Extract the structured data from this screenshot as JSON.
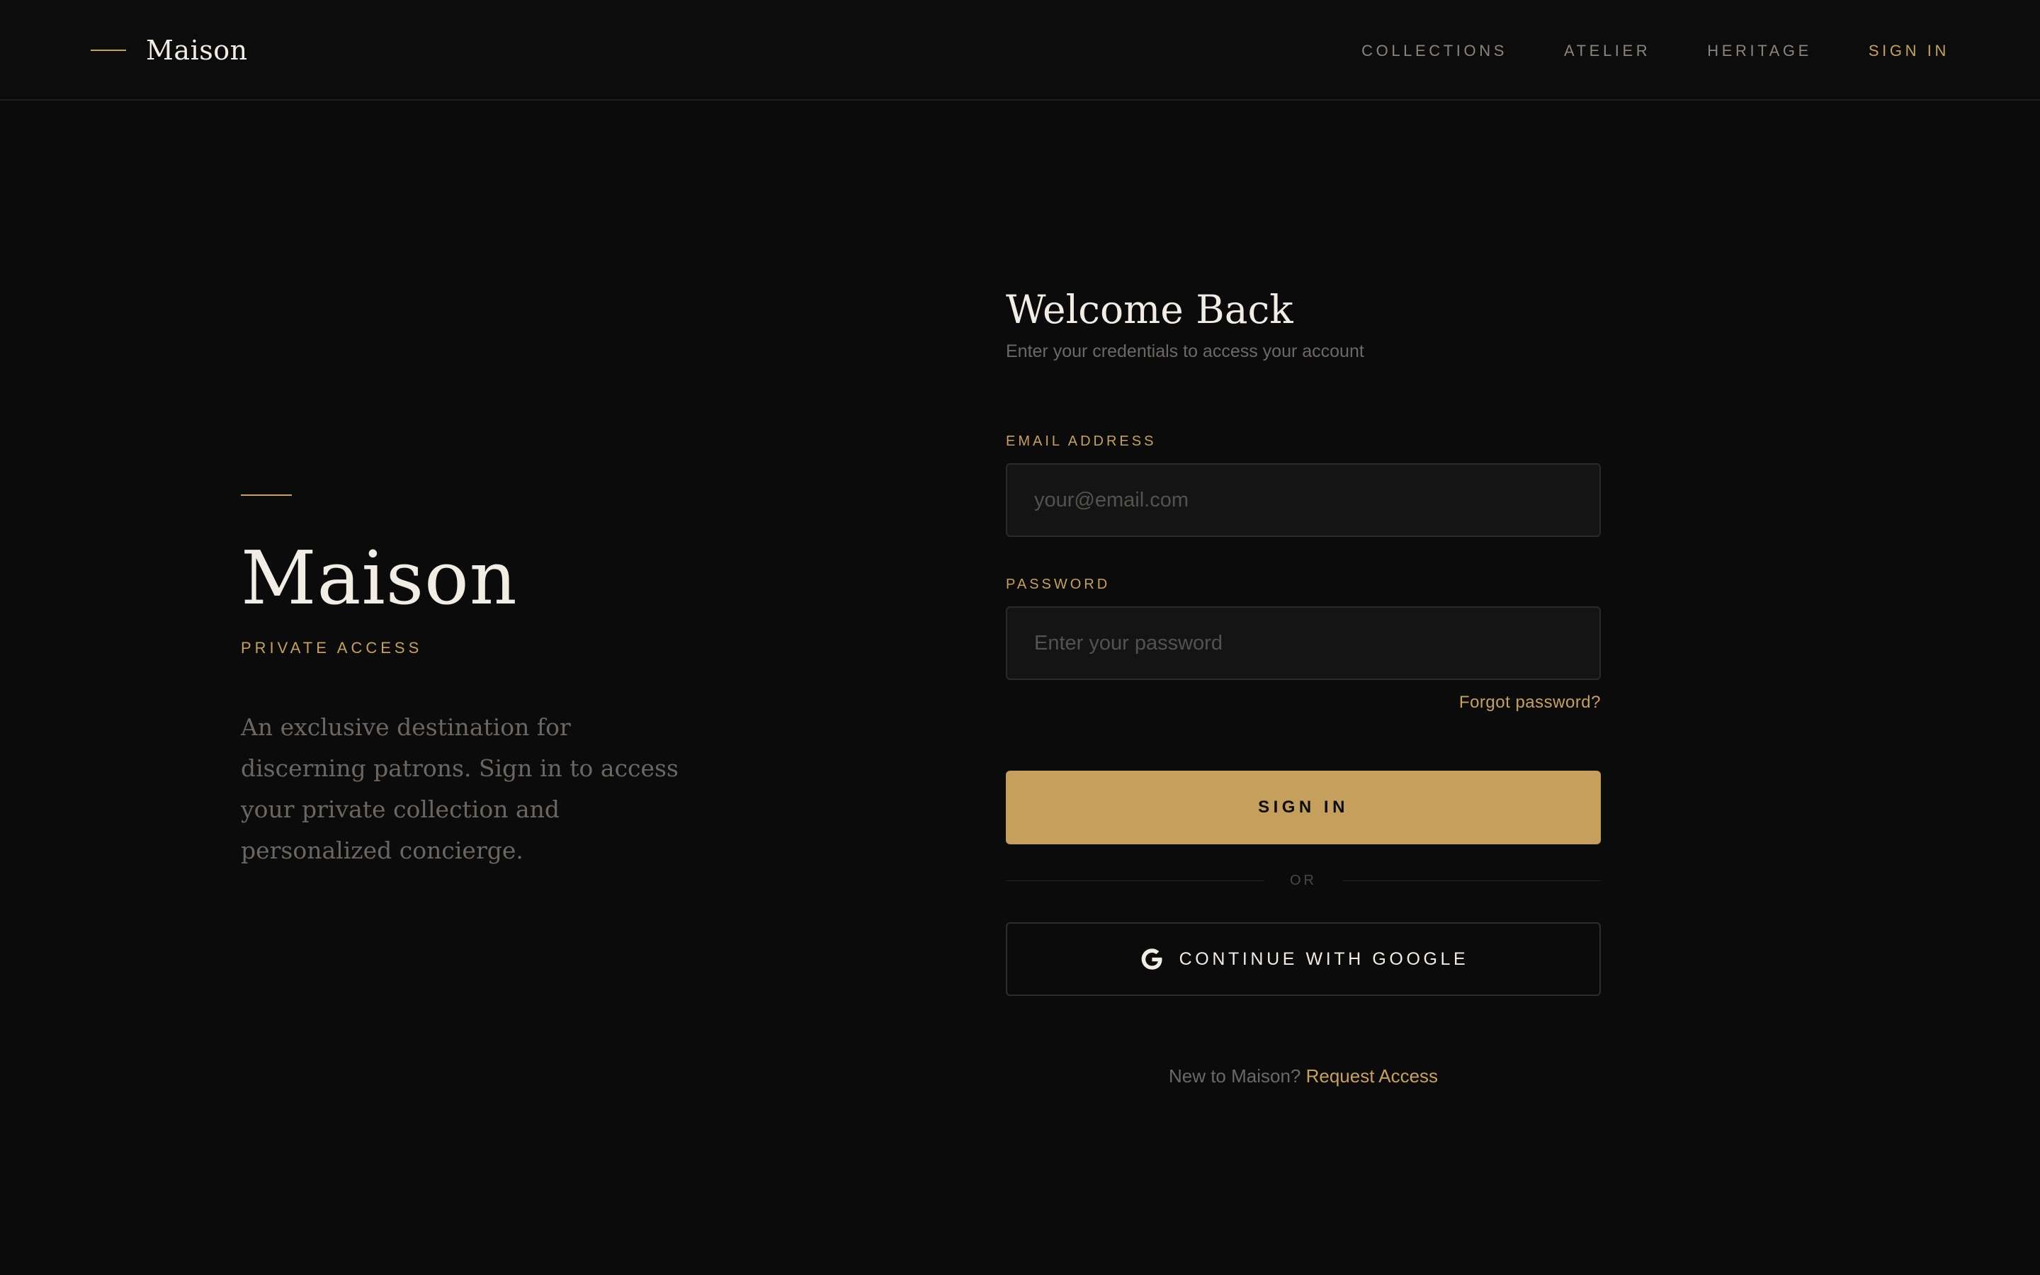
{
  "header": {
    "brand": "Maison",
    "nav": [
      {
        "label": "COLLECTIONS"
      },
      {
        "label": "ATELIER"
      },
      {
        "label": "HERITAGE"
      },
      {
        "label": "SIGN IN"
      }
    ]
  },
  "hero": {
    "title": "Maison",
    "subtitle": "PRIVATE ACCESS",
    "description": "An exclusive destination for discerning patrons. Sign in to access your private collection and personalized concierge."
  },
  "form": {
    "title": "Welcome Back",
    "subtitle": "Enter your credentials to access your account",
    "email": {
      "label": "EMAIL ADDRESS",
      "value": "",
      "placeholder": "your@email.com"
    },
    "password": {
      "label": "PASSWORD",
      "value": "",
      "placeholder": "Enter your password"
    },
    "forgot_label": "Forgot password?",
    "submit_label": "SIGN IN",
    "divider_label": "OR",
    "google_label": "CONTINUE WITH GOOGLE",
    "google_icon": "google-g-icon",
    "footer_prompt": "New to Maison?",
    "footer_link": "Request Access"
  },
  "colors": {
    "background": "#0b0b0b",
    "accent": "#c6a15b",
    "text": "#f2ede4",
    "muted": "#6d6962"
  }
}
